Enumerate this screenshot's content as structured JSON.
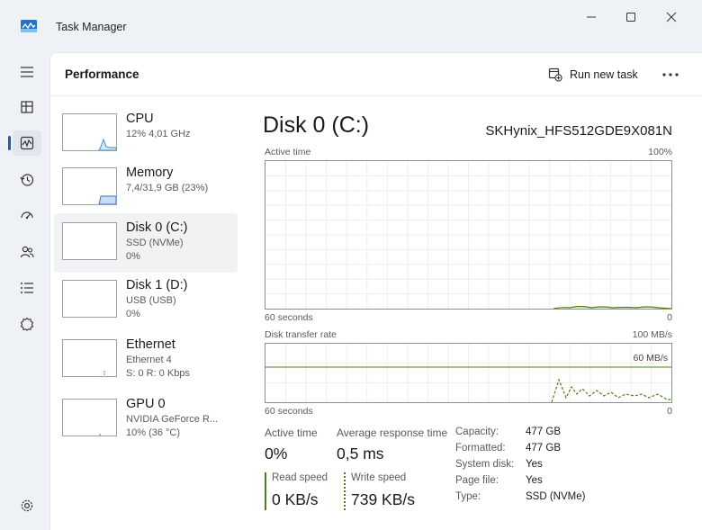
{
  "window": {
    "title": "Task Manager",
    "accent_color": "#1a5fb4"
  },
  "rail": {
    "items": [
      "hamburger-menu-icon",
      "processes-icon",
      "performance-icon",
      "app-history-icon",
      "startup-apps-icon",
      "users-icon",
      "details-icon",
      "services-icon",
      "settings-icon"
    ],
    "active": "performance-icon"
  },
  "header": {
    "title": "Performance",
    "run_new_task": "Run new task"
  },
  "devices": [
    {
      "name": "CPU",
      "sub1": "12% 4,01 GHz",
      "sub2": ""
    },
    {
      "name": "Memory",
      "sub1": "7,4/31,9 GB (23%)",
      "sub2": ""
    },
    {
      "name": "Disk 0 (C:)",
      "sub1": "SSD (NVMe)",
      "sub2": "0%"
    },
    {
      "name": "Disk 1 (D:)",
      "sub1": "USB (USB)",
      "sub2": "0%"
    },
    {
      "name": "Ethernet",
      "sub1": "Ethernet 4",
      "sub2": "S: 0 R: 0 Kbps"
    },
    {
      "name": "GPU 0",
      "sub1": "NVIDIA GeForce R...",
      "sub2": "10% (36 °C)"
    }
  ],
  "detail": {
    "title": "Disk 0 (C:)",
    "model": "SKHynix_HFS512GDE9X081N",
    "active_graph": {
      "label": "Active time",
      "max_label": "100%",
      "x_left": "60 seconds",
      "x_right": "0",
      "color": "#4e7e1a"
    },
    "transfer_graph": {
      "label": "Disk transfer rate",
      "max_label": "100 MB/s",
      "line_label": "60 MB/s",
      "line_value": 60,
      "max_value": 100,
      "x_left": "60 seconds",
      "x_right": "0",
      "color": "#4e7e1a"
    },
    "stats": {
      "active_time_label": "Active time",
      "active_time_value": "0%",
      "avg_response_label": "Average response time",
      "avg_response_value": "0,5 ms",
      "read_label": "Read speed",
      "read_value": "0 KB/s",
      "write_label": "Write speed",
      "write_value": "739 KB/s"
    },
    "properties": [
      {
        "key": "Capacity:",
        "value": "477 GB"
      },
      {
        "key": "Formatted:",
        "value": "477 GB"
      },
      {
        "key": "System disk:",
        "value": "Yes"
      },
      {
        "key": "Page file:",
        "value": "Yes"
      },
      {
        "key": "Type:",
        "value": "SSD (NVMe)"
      }
    ]
  }
}
